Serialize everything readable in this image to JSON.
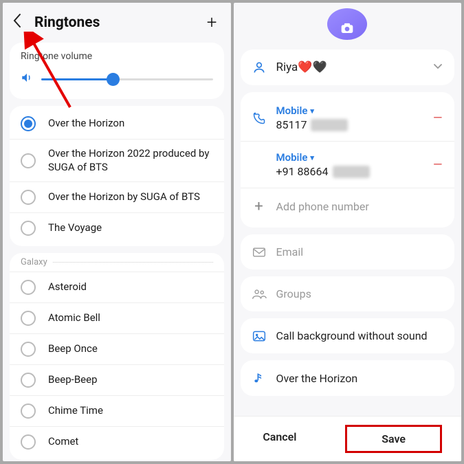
{
  "left": {
    "title": "Ringtones",
    "volume_label": "Ringtone volume",
    "slider_percent": 42,
    "ringtones_default": [
      {
        "label": "Over the Horizon",
        "selected": true
      },
      {
        "label": "Over the Horizon 2022 produced by SUGA of BTS",
        "selected": false
      },
      {
        "label": "Over the Horizon by SUGA of BTS",
        "selected": false
      },
      {
        "label": "The Voyage",
        "selected": false
      }
    ],
    "section2_title": "Galaxy",
    "ringtones_galaxy": [
      {
        "label": "Asteroid"
      },
      {
        "label": "Atomic Bell"
      },
      {
        "label": "Beep Once"
      },
      {
        "label": "Beep-Beep"
      },
      {
        "label": "Chime Time"
      },
      {
        "label": "Comet"
      }
    ]
  },
  "right": {
    "name": "Riya❤️🖤",
    "phones": [
      {
        "type": "Mobile",
        "prefix": "85117"
      },
      {
        "type": "Mobile",
        "prefix": "+91 88664"
      }
    ],
    "add_phone": "Add phone number",
    "email": "Email",
    "groups": "Groups",
    "call_bg": "Call background without sound",
    "ringtone": "Over the Horizon",
    "cancel": "Cancel",
    "save": "Save"
  }
}
